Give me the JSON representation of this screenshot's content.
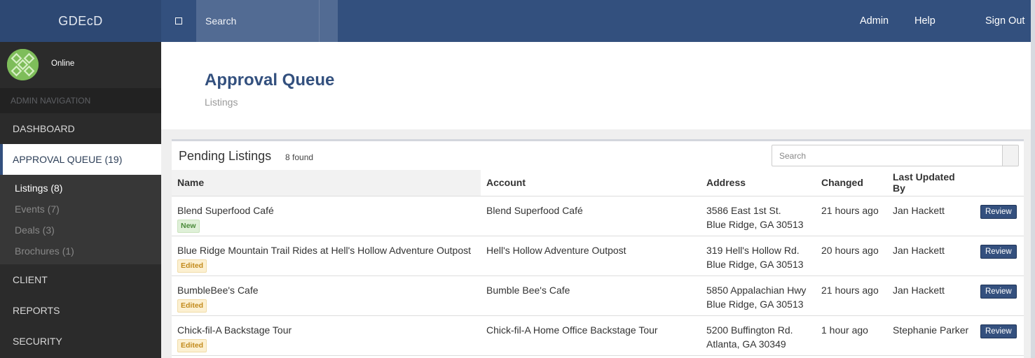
{
  "topbar": {
    "brand": "GDEcD",
    "search_placeholder": "Search",
    "links": {
      "admin": "Admin",
      "help": "Help",
      "signout": "Sign Out"
    }
  },
  "sidebar": {
    "status": "Online",
    "nav_header": "ADMIN NAVIGATION",
    "items": {
      "dashboard": "DASHBOARD",
      "approval_queue": "APPROVAL QUEUE (19)",
      "client": "CLIENT",
      "reports": "REPORTS",
      "security": "SECURITY"
    },
    "subitems": [
      "Listings (8)",
      "Events (7)",
      "Deals (3)",
      "Brochures (1)"
    ]
  },
  "page": {
    "title": "Approval Queue",
    "subtitle": "Listings"
  },
  "panel": {
    "title": "Pending Listings",
    "count": "8 found",
    "search_placeholder": "Search",
    "columns": [
      "Name",
      "Account",
      "Address",
      "Changed",
      "Last Updated By"
    ],
    "review_label": "Review",
    "rows": [
      {
        "name": "Blend Superfood Café",
        "badge": "New",
        "badge_type": "new",
        "account": "Blend Superfood Café",
        "address1": "3586 East 1st St.",
        "address2": "Blue Ridge, GA 30513",
        "changed": "21 hours ago",
        "updated_by": "Jan Hackett"
      },
      {
        "name": "Blue Ridge Mountain Trail Rides at Hell's Hollow Adventure Outpost",
        "badge": "Edited",
        "badge_type": "edited",
        "account": "Hell's Hollow Adventure Outpost",
        "address1": "319 Hell's Hollow Rd.",
        "address2": "Blue Ridge, GA 30513",
        "changed": "20 hours ago",
        "updated_by": "Jan Hackett"
      },
      {
        "name": "BumbleBee's Cafe",
        "badge": "Edited",
        "badge_type": "edited",
        "account": "Bumble Bee's Cafe",
        "address1": "5850 Appalachian Hwy",
        "address2": "Blue Ridge, GA 30513",
        "changed": "21 hours ago",
        "updated_by": "Jan Hackett"
      },
      {
        "name": "Chick-fil-A Backstage Tour",
        "badge": "Edited",
        "badge_type": "edited",
        "account": "Chick-fil-A Home Office Backstage Tour",
        "address1": "5200 Buffington Rd.",
        "address2": "Atlanta, GA 30349",
        "changed": "1 hour ago",
        "updated_by": "Stephanie Parker"
      }
    ]
  },
  "colors": {
    "topbar": "#33507e",
    "brand_bg": "#2d4873",
    "sidebar_bg": "#2b2b2b",
    "accent": "#33507e",
    "badge_new": "#dff0d8",
    "badge_edited": "#fcf0d1"
  }
}
